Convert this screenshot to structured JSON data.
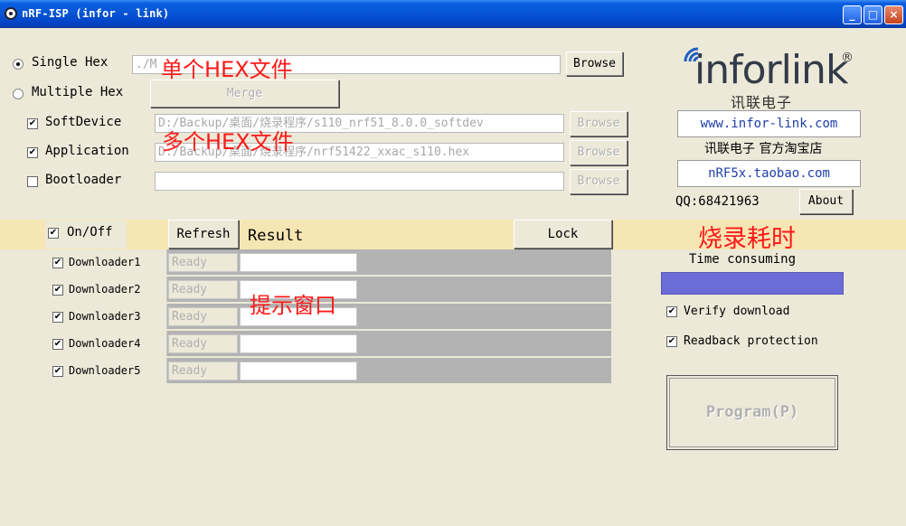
{
  "window": {
    "title": "nRF-ISP (infor - link)",
    "minimize": "_",
    "maximize": "□",
    "close": "×"
  },
  "mode": {
    "single_label": "Single Hex",
    "single_path": "./M",
    "browse_label": "Browse",
    "multiple_label": "Multiple Hex",
    "merge_label": "Merge"
  },
  "files": [
    {
      "label": "SoftDevice",
      "path": "D:/Backup/桌面/烧录程序/s110_nrf51_8.0.0_softdev",
      "browse": "Browse",
      "checked": true
    },
    {
      "label": "Application",
      "path": "D:/Backup/桌面/烧录程序/nrf51422_xxac_s110.hex",
      "browse": "Browse",
      "checked": true
    },
    {
      "label": "Bootloader",
      "path": "",
      "browse": "Browse",
      "checked": false
    }
  ],
  "annotations": {
    "single_hex": "单个HEX文件",
    "multi_hex": "多个HEX文件",
    "hint_window": "提示窗口",
    "burn_time": "烧录耗时"
  },
  "brand": {
    "logo": "inforlink",
    "registered": "®",
    "chinese": "讯联电子",
    "website": "www.infor-link.com",
    "shop_label": "讯联电子 官方淘宝店",
    "taobao": "nRF5x.taobao.com",
    "qq": "QQ:68421963",
    "about": "About"
  },
  "toolbar": {
    "onoff_label": "On/Off",
    "refresh_label": "Refresh",
    "result_label": "Result",
    "lock_label": "Lock"
  },
  "downloaders": [
    {
      "name": "Downloader1",
      "status": "Ready"
    },
    {
      "name": "Downloader2",
      "status": "Ready"
    },
    {
      "name": "Downloader3",
      "status": "Ready"
    },
    {
      "name": "Downloader4",
      "status": "Ready"
    },
    {
      "name": "Downloader5",
      "status": "Ready"
    }
  ],
  "options": {
    "time_label": "Time consuming",
    "verify_label": "Verify download",
    "readback_label": "Readback protection",
    "program_label": "Program(P)"
  },
  "colors": {
    "progress": "#6c6cd6",
    "annotation": "#ff1a1a"
  }
}
